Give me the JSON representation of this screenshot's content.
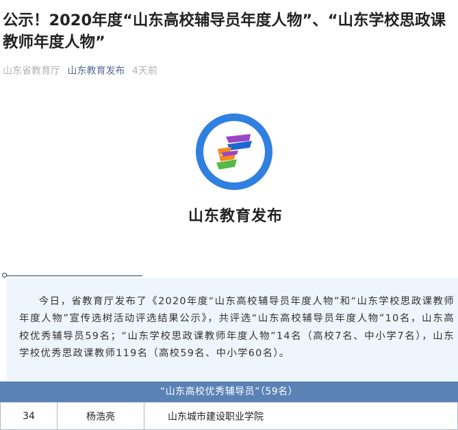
{
  "article": {
    "title": "公示！2020年度“山东高校辅导员年度人物”、“山东学校思政课教师年度人物”",
    "source": "山东省教育厅",
    "account": "山东教育发布",
    "time": "4天前"
  },
  "logo": {
    "text": "山东教育发布",
    "icon": "shandong-education-emblem-icon",
    "colors": {
      "ring": "#2f80e0",
      "green": "#56b847",
      "orange": "#f28a1e",
      "purple": "#9b45c7",
      "blue": "#1f66d1"
    }
  },
  "intro": {
    "text": "今日，省教育厅发布了《2020年度“山东高校辅导员年度人物”和“山东学校思政课教师年度人物”宣传选树活动评选结果公示》，共评选“山东高校辅导员年度人物”10名，山东高校优秀辅导员59名；“山东学校思政课教师年度人物”14名（高校7名、中小学7名），山东学校优秀思政课教师119名（高校59名、中小学60名）。"
  },
  "table": {
    "header": "“山东高校优秀辅导员”（59名）",
    "rows": [
      {
        "no": "34",
        "name": "杨浩亮",
        "school": "山东城市建设职业学院"
      }
    ]
  },
  "colors": {
    "account_link": "#576b95",
    "meta_gray": "#b2b2b2",
    "intro_bg": "#eef5fc",
    "table_header_bg": "#5b82b5"
  }
}
